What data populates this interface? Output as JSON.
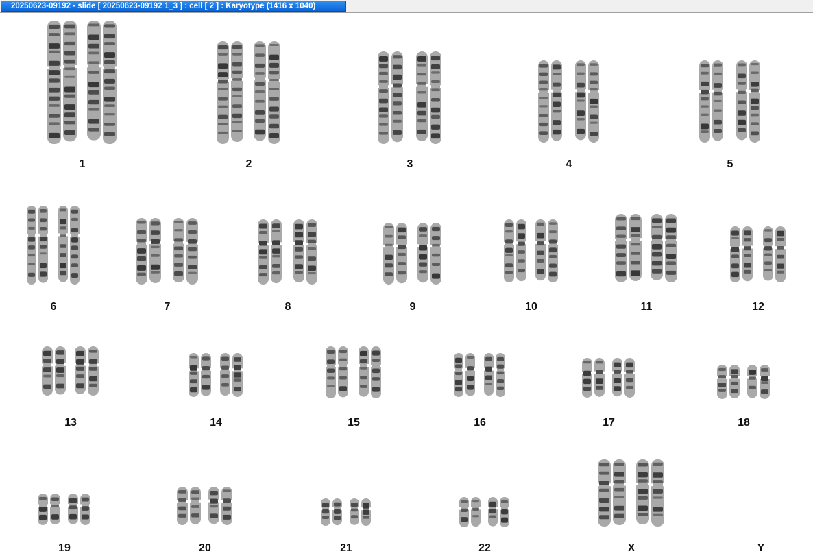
{
  "window": {
    "title": "20250623-09192 - slide [ 20250623-09192 1_3 ] : cell [ 2 ] : Karyotype  (1416 x 1040)"
  },
  "karyotype": {
    "labels": [
      "1",
      "2",
      "3",
      "4",
      "5",
      "6",
      "7",
      "8",
      "9",
      "10",
      "11",
      "12",
      "13",
      "14",
      "15",
      "16",
      "17",
      "18",
      "19",
      "20",
      "21",
      "22",
      "X",
      "Y"
    ]
  },
  "colors": {
    "title_active": "#0a64d6",
    "chromosome_dark": "#2a2a2a",
    "chromosome_light": "#9a9a9a"
  }
}
